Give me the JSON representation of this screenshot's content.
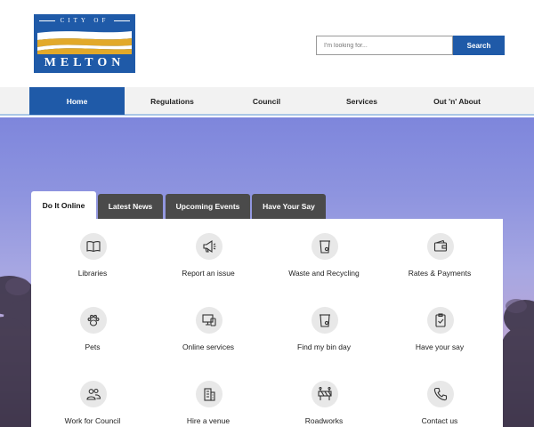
{
  "logo": {
    "top_text": "CITY OF",
    "name": "MELTON",
    "colors": {
      "blue": "#1f5aa8",
      "gold": "#e2a92a"
    }
  },
  "search": {
    "placeholder": "I'm looking for...",
    "button_label": "Search"
  },
  "nav": {
    "items": [
      {
        "label": "Home",
        "active": true
      },
      {
        "label": "Regulations"
      },
      {
        "label": "Council"
      },
      {
        "label": "Services"
      },
      {
        "label": "Out 'n' About"
      }
    ]
  },
  "tabs": [
    {
      "label": "Do It Online",
      "active": true
    },
    {
      "label": "Latest News"
    },
    {
      "label": "Upcoming Events"
    },
    {
      "label": "Have Your Say"
    }
  ],
  "tiles": [
    {
      "label": "Libraries",
      "icon": "book-icon"
    },
    {
      "label": "Report an issue",
      "icon": "megaphone-icon"
    },
    {
      "label": "Waste and Recycling",
      "icon": "bin-icon"
    },
    {
      "label": "Rates & Payments",
      "icon": "wallet-icon"
    },
    {
      "label": "Pets",
      "icon": "paw-icon"
    },
    {
      "label": "Online services",
      "icon": "devices-icon"
    },
    {
      "label": "Find my bin day",
      "icon": "bin-icon"
    },
    {
      "label": "Have your say",
      "icon": "clipboard-check-icon"
    },
    {
      "label": "Work for Council",
      "icon": "people-icon"
    },
    {
      "label": "Hire a venue",
      "icon": "building-icon"
    },
    {
      "label": "Roadworks",
      "icon": "roadblock-icon"
    },
    {
      "label": "Contact us",
      "icon": "phone-icon"
    }
  ],
  "colors": {
    "brand_blue": "#1f5aa8",
    "tab_dark": "#4a4a4a",
    "icon_bg": "#e8e8e8"
  }
}
